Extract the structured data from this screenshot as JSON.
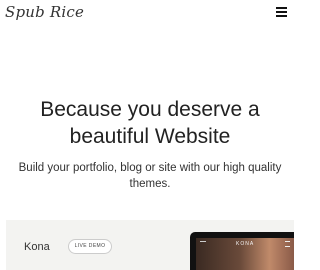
{
  "header": {
    "logo_text": "Spub Rice"
  },
  "hero": {
    "title_line1": "Because you deserve a",
    "title_line2": "beautiful Website",
    "subtitle_line1": "Build your portfolio, blog or site with our high quality",
    "subtitle_line2": "themes."
  },
  "demo": {
    "theme_name": "Kona",
    "live_demo_label": "LIVE DEMO",
    "preview_title": "KONA"
  },
  "icons": {
    "menu": "hamburger-menu-icon"
  },
  "colors": {
    "background": "#ffffff",
    "card_background": "#f3f3f1",
    "text": "#222222"
  }
}
